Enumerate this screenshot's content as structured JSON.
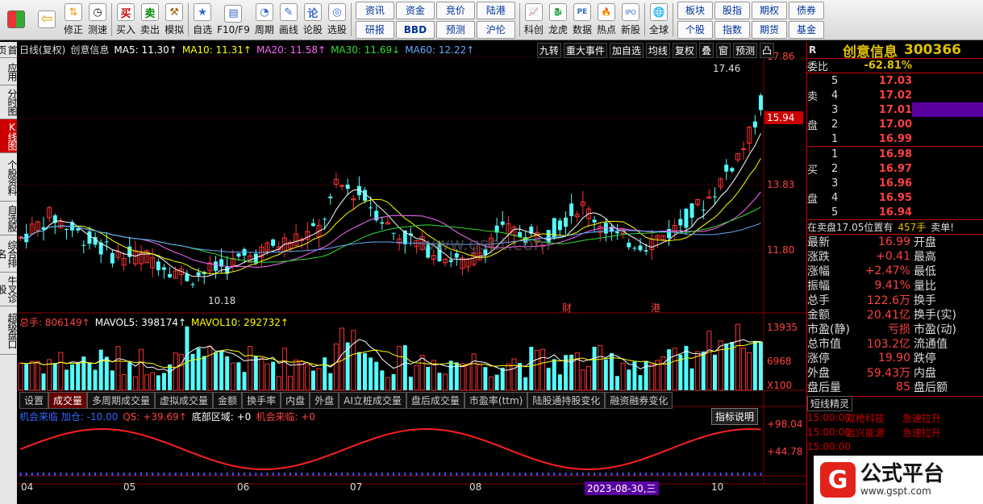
{
  "toolbar": {
    "left": [
      {
        "label": "",
        "icon": "grid-icon"
      },
      {
        "label": "",
        "icon": "back-arrow-icon"
      },
      {
        "label": "修正",
        "icon": "updown-arrow-icon"
      },
      {
        "label": "测速",
        "icon": "clock-icon"
      }
    ],
    "trade": [
      {
        "label": "买入",
        "icon": "buy-icon",
        "glyph": "买"
      },
      {
        "label": "卖出",
        "icon": "sell-icon",
        "glyph": "卖"
      },
      {
        "label": "模拟",
        "icon": "hammer-icon",
        "glyph": "⚒"
      }
    ],
    "view": [
      {
        "label": "自选",
        "glyph": "★"
      },
      {
        "label": "F10/F9",
        "glyph": "▤"
      },
      {
        "label": "周期",
        "glyph": "◔"
      },
      {
        "label": "画线",
        "glyph": "✎"
      },
      {
        "label": "论股",
        "glyph": "论"
      },
      {
        "label": "选股",
        "glyph": "◎"
      }
    ],
    "grid1": [
      "资讯",
      "资金",
      "竞价",
      "陆港",
      "研报",
      "BBD",
      "预测",
      "沪伦"
    ],
    "grid2": [
      {
        "label": "科创",
        "glyph": "📈"
      },
      {
        "label": "龙虎",
        "glyph": "🐉"
      },
      {
        "label": "数据",
        "glyph": "PE"
      },
      {
        "label": "热点",
        "glyph": "🔥"
      },
      {
        "label": "新股",
        "glyph": "IPO"
      }
    ],
    "world": {
      "label": "全球",
      "glyph": "🌐"
    },
    "grid3": [
      "板块",
      "股指",
      "期权",
      "债券",
      "个股",
      "指数",
      "期货",
      "基金"
    ]
  },
  "lefttabs": [
    {
      "label": "首页",
      "active": false
    },
    {
      "label": "应用",
      "active": false
    },
    {
      "label": "分时图",
      "active": false
    },
    {
      "label": "K线图",
      "active": true
    },
    {
      "label": "个股资料",
      "active": false
    },
    {
      "label": "自选股",
      "active": false
    },
    {
      "label": "综合排名",
      "active": false
    },
    {
      "label": "牛叉诊股",
      "active": false
    },
    {
      "label": "超级盘口",
      "active": false
    }
  ],
  "chart": {
    "ma": [
      {
        "text": "日线(复权)",
        "color": "#dddddd"
      },
      {
        "text": "创意信息",
        "color": "#dddddd"
      },
      {
        "text": "MA5: 11.30↑",
        "color": "#ffffff"
      },
      {
        "text": "MA10: 11.31↑",
        "color": "#ffff00"
      },
      {
        "text": "MA20: 11.58↑",
        "color": "#ff66ff"
      },
      {
        "text": "MA30: 11.69↓",
        "color": "#33dd33"
      },
      {
        "text": "MA60: 12.22↑",
        "color": "#66aaff"
      }
    ],
    "topbtns": [
      "九转",
      "重大事件",
      "加自选",
      "均线",
      "复权",
      "叠",
      "窗",
      "预测",
      "凸"
    ],
    "price_axis": [
      "17.86",
      "15.94",
      "13.83",
      "11.80"
    ],
    "current_price_tag": "15.94",
    "high_label": "17.46",
    "low_label": "10.18",
    "events": [
      "财",
      "港"
    ],
    "watermark": "www.gspt.com",
    "vol_legend": [
      {
        "text": "总手: 806149↑",
        "color": "#ff4040"
      },
      {
        "text": "MAVOL5: 398174↑",
        "color": "#ffffff"
      },
      {
        "text": "MAVOL10: 292732↑",
        "color": "#ffff00"
      }
    ],
    "vol_axis": [
      "13935",
      "6968",
      "X100"
    ],
    "ind_tabs": [
      "设置",
      "成交量",
      "多周期成交量",
      "虚拟成交量",
      "金额",
      "换手率",
      "内盘",
      "外盘",
      "AI立桩成交量",
      "盘后成交量",
      "市盈率(ttm)",
      "陆股通持股变化",
      "融资融券变化"
    ],
    "ind_active": "成交量",
    "ind_legend": [
      {
        "text": "机会来临 加仓: -10.00",
        "color": "#3366ff"
      },
      {
        "text": "QS: +39.69↑",
        "color": "#ff4040"
      },
      {
        "text": "底部区域: +0",
        "color": "#ffffff"
      },
      {
        "text": "机会来临: +0",
        "color": "#ff4040"
      }
    ],
    "ind_button": "指标说明",
    "ind_axis": [
      "+98.04",
      "+44.78"
    ],
    "months": [
      {
        "label": "04",
        "x": 4
      },
      {
        "label": "05",
        "x": 131
      },
      {
        "label": "06",
        "x": 272
      },
      {
        "label": "07",
        "x": 412
      },
      {
        "label": "08",
        "x": 560
      },
      {
        "label": "10",
        "x": 860
      }
    ],
    "cursor_date": "2023-08-30,三"
  },
  "chart_data": {
    "type": "candlestick",
    "x": [
      "04",
      "05",
      "06",
      "07",
      "08",
      "10"
    ],
    "ylim": [
      9.5,
      18.5
    ],
    "high": 17.46,
    "low": 10.18,
    "last": 16.99,
    "ma": {
      "MA5": 11.3,
      "MA10": 11.31,
      "MA20": 11.58,
      "MA30": 11.69,
      "MA60": 12.22
    }
  },
  "quote": {
    "name": "创意信息",
    "code": "300366",
    "r": "R",
    "weibi_label": "委比",
    "weibi": "-62.81%",
    "sell_label": "卖盘",
    "buy_label": "买盘",
    "sell": [
      {
        "n": "5",
        "p": "17.03",
        "v": ""
      },
      {
        "n": "4",
        "p": "17.02",
        "v": ""
      },
      {
        "n": "3",
        "p": "17.01",
        "v": ""
      },
      {
        "n": "2",
        "p": "17.00",
        "v": ""
      },
      {
        "n": "1",
        "p": "16.99",
        "v": ""
      }
    ],
    "buy": [
      {
        "n": "1",
        "p": "16.98",
        "v": ""
      },
      {
        "n": "2",
        "p": "16.97",
        "v": ""
      },
      {
        "n": "3",
        "p": "16.96",
        "v": ""
      },
      {
        "n": "4",
        "p": "16.95",
        "v": ""
      },
      {
        "n": "5",
        "p": "16.94",
        "v": ""
      }
    ],
    "note_a": "在卖盘17.05位置有",
    "note_b": "457手",
    "note_c": "卖单!",
    "info": [
      {
        "k": "最新",
        "v": "16.99",
        "k2": "开盘"
      },
      {
        "k": "涨跌",
        "v": "+0.41",
        "k2": "最高"
      },
      {
        "k": "涨幅",
        "v": "+2.47%",
        "k2": "最低"
      },
      {
        "k": "振幅",
        "v": "9.41%",
        "k2": "量比"
      },
      {
        "k": "总手",
        "v": "122.6万",
        "k2": "换手"
      },
      {
        "k": "金额",
        "v": "20.41亿",
        "k2": "换手(实)"
      },
      {
        "k": "市盈(静)",
        "v": "亏损",
        "k2": "市盈(动)"
      },
      {
        "k": "总市值",
        "v": "103.2亿",
        "k2": "流通值"
      },
      {
        "k": "涨停",
        "v": "19.90",
        "k2": "跌停"
      },
      {
        "k": "外盘",
        "v": "59.43万",
        "k2": "内盘"
      },
      {
        "k": "盘后量",
        "v": "85",
        "k2": "盘后额"
      }
    ],
    "short_title": "短线精灵",
    "short": [
      {
        "t": "15:00:00",
        "n": "双枪科技",
        "e": "急速拉升"
      },
      {
        "t": "15:00:00",
        "n": "远兴能源",
        "e": "急速拉升"
      },
      {
        "t": "15:00:00",
        "n": "",
        "e": ""
      }
    ]
  },
  "logo": {
    "text": "公式平台",
    "url": "www.gspt.com"
  }
}
